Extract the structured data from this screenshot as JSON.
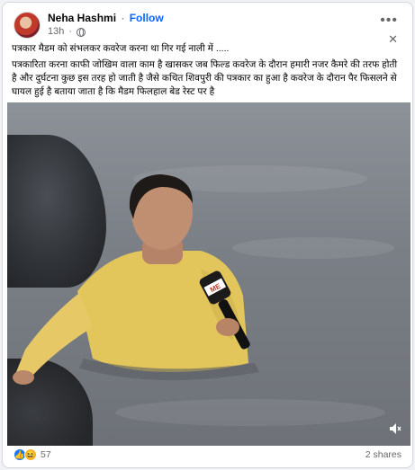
{
  "post": {
    "author": "Neha Hashmi",
    "separator": "·",
    "follow_label": "Follow",
    "time": "13h",
    "title": "पत्रकार मैडम को संभलकर कवरेज करना था गिर गई नाली में .....",
    "body": "पत्रकारिता करना काफी जोखिम वाला काम है खासकर जब फिल्ड कवरेज के दौरान हमारी नजर कैमरे की तरफ होती है और दुर्घटना कुछ इस तरह हो जाती है जैसे कथित शिवपुरी की पत्रकार का हुआ है कवरेज के दौरान पैर फिसलने से घायल हुई है बताया जाता है कि मैडम फिलहाल बेड रेस्ट पर है",
    "mic_label": "ME"
  },
  "footer": {
    "reaction_count": "57",
    "shares": "2 shares"
  },
  "icons": {
    "more": "more-options-icon",
    "close": "close-icon",
    "audience": "globe-icon",
    "mute": "volume-muted-icon"
  },
  "colors": {
    "follow": "#0866ff",
    "like": "#1877f2",
    "haha": "#f7b125"
  }
}
